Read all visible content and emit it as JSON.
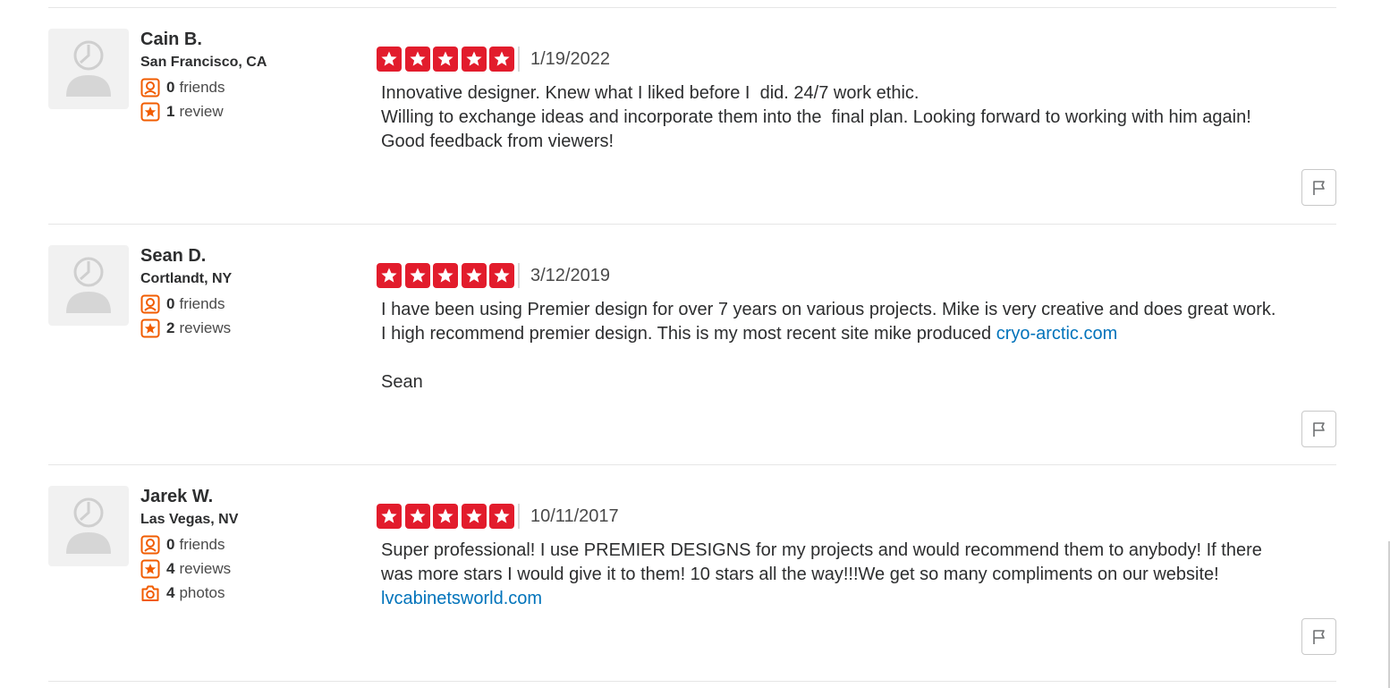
{
  "reviews": [
    {
      "user": {
        "name": "Cain B.",
        "location": "San Francisco, CA",
        "friends_count": "0",
        "friends_label": "friends",
        "reviews_count": "1",
        "reviews_label": "review"
      },
      "rating": 5,
      "date": "1/19/2022",
      "text_lines": [
        "Innovative designer. Knew what I liked before I  did. 24/7 work ethic.",
        "Willing to exchange ideas and incorporate them into the  final plan. Looking forward to working with him again!",
        "Good feedback from viewers!"
      ]
    },
    {
      "user": {
        "name": "Sean D.",
        "location": "Cortlandt, NY",
        "friends_count": "0",
        "friends_label": "friends",
        "reviews_count": "2",
        "reviews_label": "reviews"
      },
      "rating": 5,
      "date": "3/12/2019",
      "text_lines": [
        "I have been using Premier design for over 7 years on various projects. Mike is very creative and does great work.",
        "I high recommend premier design. This is my most recent site mike produced "
      ],
      "link": "cryo-arctic.com",
      "signoff": "Sean"
    },
    {
      "user": {
        "name": "Jarek W.",
        "location": "Las Vegas, NV",
        "friends_count": "0",
        "friends_label": "friends",
        "reviews_count": "4",
        "reviews_label": "reviews",
        "photos_count": "4",
        "photos_label": "photos"
      },
      "rating": 5,
      "date": "10/11/2017",
      "text_lines": [
        "Super professional! I use PREMIER DESIGNS for my projects and would recommend them to anybody! If there",
        "was more stars I would give it to them! 10 stars all the way!!!We get so many compliments on our website!"
      ],
      "link": "lvcabinetsworld.com"
    }
  ],
  "colors": {
    "star_red": "#e21c2c",
    "stat_icon_orange": "#f15c00",
    "link_blue": "#0073bb",
    "divider": "#e6e6e6"
  },
  "icons": {
    "friends": "friends-icon",
    "reviews": "review-star-icon",
    "photos": "camera-icon",
    "flag": "flag-icon",
    "avatar": "default-avatar-icon"
  }
}
